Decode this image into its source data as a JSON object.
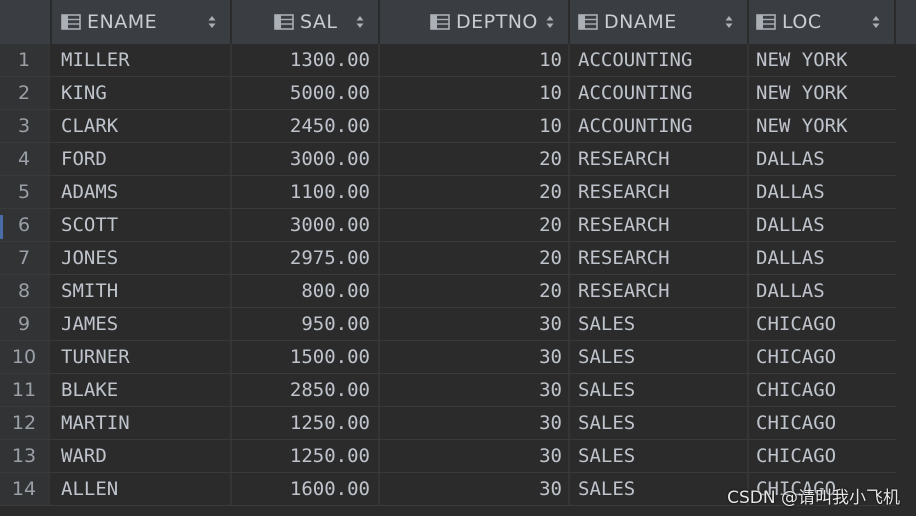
{
  "columns": [
    {
      "key": "ename",
      "label": "ENAME"
    },
    {
      "key": "sal",
      "label": "SAL"
    },
    {
      "key": "deptno",
      "label": "DEPTNO"
    },
    {
      "key": "dname",
      "label": "DNAME"
    },
    {
      "key": "loc",
      "label": "LOC"
    }
  ],
  "rows": [
    {
      "n": "1",
      "ename": "MILLER",
      "sal": "1300.00",
      "deptno": "10",
      "dname": "ACCOUNTING",
      "loc": "NEW YORK"
    },
    {
      "n": "2",
      "ename": "KING",
      "sal": "5000.00",
      "deptno": "10",
      "dname": "ACCOUNTING",
      "loc": "NEW YORK"
    },
    {
      "n": "3",
      "ename": "CLARK",
      "sal": "2450.00",
      "deptno": "10",
      "dname": "ACCOUNTING",
      "loc": "NEW YORK"
    },
    {
      "n": "4",
      "ename": "FORD",
      "sal": "3000.00",
      "deptno": "20",
      "dname": "RESEARCH",
      "loc": "DALLAS"
    },
    {
      "n": "5",
      "ename": "ADAMS",
      "sal": "1100.00",
      "deptno": "20",
      "dname": "RESEARCH",
      "loc": "DALLAS"
    },
    {
      "n": "6",
      "ename": "SCOTT",
      "sal": "3000.00",
      "deptno": "20",
      "dname": "RESEARCH",
      "loc": "DALLAS"
    },
    {
      "n": "7",
      "ename": "JONES",
      "sal": "2975.00",
      "deptno": "20",
      "dname": "RESEARCH",
      "loc": "DALLAS"
    },
    {
      "n": "8",
      "ename": "SMITH",
      "sal": "800.00",
      "deptno": "20",
      "dname": "RESEARCH",
      "loc": "DALLAS"
    },
    {
      "n": "9",
      "ename": "JAMES",
      "sal": "950.00",
      "deptno": "30",
      "dname": "SALES",
      "loc": "CHICAGO"
    },
    {
      "n": "10",
      "ename": "TURNER",
      "sal": "1500.00",
      "deptno": "30",
      "dname": "SALES",
      "loc": "CHICAGO"
    },
    {
      "n": "11",
      "ename": "BLAKE",
      "sal": "2850.00",
      "deptno": "30",
      "dname": "SALES",
      "loc": "CHICAGO"
    },
    {
      "n": "12",
      "ename": "MARTIN",
      "sal": "1250.00",
      "deptno": "30",
      "dname": "SALES",
      "loc": "CHICAGO"
    },
    {
      "n": "13",
      "ename": "WARD",
      "sal": "1250.00",
      "deptno": "30",
      "dname": "SALES",
      "loc": "CHICAGO"
    },
    {
      "n": "14",
      "ename": "ALLEN",
      "sal": "1600.00",
      "deptno": "30",
      "dname": "SALES",
      "loc": "CHICAGO"
    }
  ],
  "watermark": "CSDN @请叫我小飞机",
  "icons": {
    "column": "table-column-icon",
    "sort": "sort-arrows-icon"
  },
  "colors": {
    "background": "#2b2b2b",
    "header": "#3a3d41",
    "text": "#bfc4cc"
  }
}
